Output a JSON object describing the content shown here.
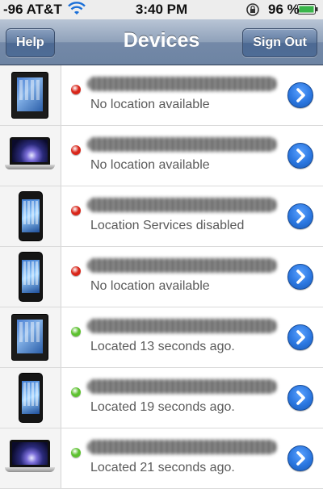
{
  "status_bar": {
    "carrier": "-96 AT&T",
    "time": "3:40 PM",
    "battery_percent": "96 %",
    "icons": [
      "wifi-icon",
      "rotation-lock-icon",
      "battery-icon"
    ]
  },
  "nav": {
    "left_button": "Help",
    "title": "Devices",
    "right_button": "Sign Out"
  },
  "colors": {
    "status_offline": "#d8261a",
    "status_online": "#5cc02f",
    "disclosure_blue": "#2b77e0"
  },
  "devices": [
    {
      "type": "ipad-icon",
      "online": false,
      "status": "No location available"
    },
    {
      "type": "macbook-icon",
      "online": false,
      "status": "No location available"
    },
    {
      "type": "iphone-icon",
      "online": false,
      "status": "Location Services disabled"
    },
    {
      "type": "iphone-icon",
      "online": false,
      "status": "No location available"
    },
    {
      "type": "ipad-icon",
      "online": true,
      "status": "Located 13 seconds ago."
    },
    {
      "type": "iphone-icon",
      "online": true,
      "status": "Located 19 seconds ago."
    },
    {
      "type": "macbook-icon",
      "online": true,
      "status": "Located 21 seconds ago."
    }
  ]
}
